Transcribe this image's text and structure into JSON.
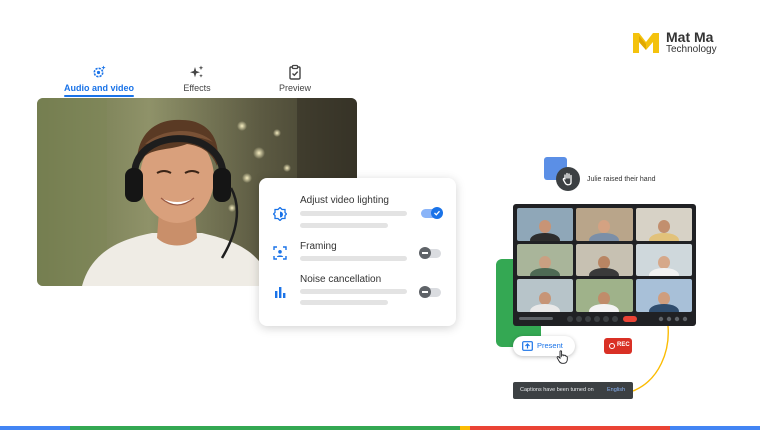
{
  "brand": {
    "name": "Mat Ma",
    "subtitle": "Technology"
  },
  "tabs": [
    {
      "label": "Audio and video",
      "icon": "gear-sparkle-icon",
      "active": true
    },
    {
      "label": "Effects",
      "icon": "sparkle-icon",
      "active": false
    },
    {
      "label": "Preview",
      "icon": "clipboard-check-icon",
      "active": false
    }
  ],
  "settings": {
    "items": [
      {
        "label": "Adjust video lighting",
        "icon": "brightness-icon",
        "enabled": true
      },
      {
        "label": "Framing",
        "icon": "framing-icon",
        "enabled": false
      },
      {
        "label": "Noise cancellation",
        "icon": "audio-levels-icon",
        "enabled": false
      }
    ]
  },
  "meeting": {
    "raised_hand_text": "Julie raised their hand",
    "present_label": "Present",
    "rec_label": "REC",
    "captions_text": "Captions have been turned on",
    "captions_language": "English"
  },
  "colors": {
    "accent": "#1a73e8",
    "google_blue": "#4285f4",
    "google_red": "#ea4335",
    "google_yellow": "#fbbc04",
    "google_green": "#34a853",
    "rec_red": "#d93025"
  }
}
